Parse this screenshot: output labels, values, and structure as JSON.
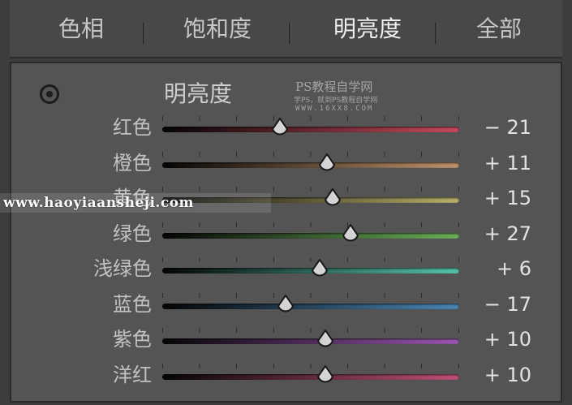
{
  "tabs": [
    {
      "label": "色相",
      "active": false
    },
    {
      "label": "饱和度",
      "active": false
    },
    {
      "label": "明亮度",
      "active": true
    },
    {
      "label": "全部",
      "active": false
    }
  ],
  "panel": {
    "title": "明亮度",
    "target_icon": "target-adjust-icon"
  },
  "watermark": {
    "line1": "PS教程自学网",
    "line2": "学PS，就到PS教程自学网",
    "line3": "WWW.16XX8.COM",
    "url": "www.haoyiaansheji.com"
  },
  "sliders": [
    {
      "label": "红色",
      "value_text": "− 21",
      "value": -21,
      "color": "#c84a5e"
    },
    {
      "label": "橙色",
      "value_text": "+ 11",
      "value": 11,
      "color": "#c0926a"
    },
    {
      "label": "黄色",
      "value_text": "+ 15",
      "value": 15,
      "color": "#b8b06a"
    },
    {
      "label": "绿色",
      "value_text": "+ 27",
      "value": 27,
      "color": "#6cb05a"
    },
    {
      "label": "浅绿色",
      "value_text": "+ 6",
      "value": 6,
      "color": "#56c4ac"
    },
    {
      "label": "蓝色",
      "value_text": "− 17",
      "value": -17,
      "color": "#4a86b6"
    },
    {
      "label": "紫色",
      "value_text": "+ 10",
      "value": 10,
      "color": "#9a56b0"
    },
    {
      "label": "洋红",
      "value_text": "+ 10",
      "value": 10,
      "color": "#c0507a"
    }
  ],
  "slider_range": [
    -100,
    100
  ]
}
